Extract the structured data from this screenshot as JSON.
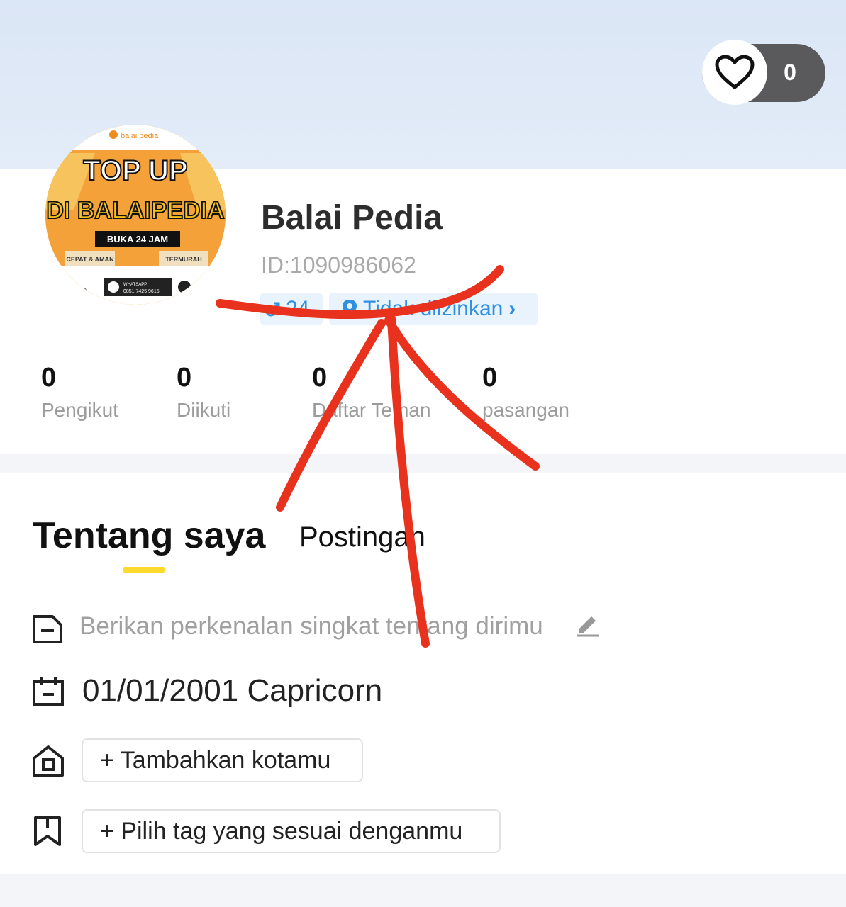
{
  "header": {
    "like_count": "0"
  },
  "avatar": {
    "brand": "balai pedia",
    "headline_top": "TOP UP",
    "headline_bottom": "DI BALAIPEDIA",
    "hours": "BUKA 24 JAM",
    "left_tag": "CEPAT & AMAN",
    "right_tag": "TERMURAH",
    "whatsapp_label": "WHATSAPP",
    "whatsapp_number": "0851 7425 9615",
    "left_fragment": "EDIA"
  },
  "profile": {
    "name": "Balai Pedia",
    "id": "ID:1090986062",
    "age_chip": "24",
    "location_chip": "Tidak diizinkan",
    "chevron": "›"
  },
  "stats": [
    {
      "value": "0",
      "label": "Pengikut"
    },
    {
      "value": "0",
      "label": "Diikuti"
    },
    {
      "value": "0",
      "label": "Daftar Teman"
    },
    {
      "value": "0",
      "label": "pasangan"
    }
  ],
  "tabs": {
    "about": "Tentang saya",
    "posts": "Postingan"
  },
  "about": {
    "intro_placeholder": "Berikan perkenalan singkat tentang dirimu",
    "birthday": "01/01/2001  Capricorn",
    "add_city": "+ Tambahkan kotamu",
    "choose_tag": "+ Pilih tag yang sesuai denganmu"
  },
  "colors": {
    "banner": "#dbe6f6",
    "accent_underline": "#ffd92e",
    "chip_text": "#2f8fe0",
    "annotation": "#e8321e"
  }
}
